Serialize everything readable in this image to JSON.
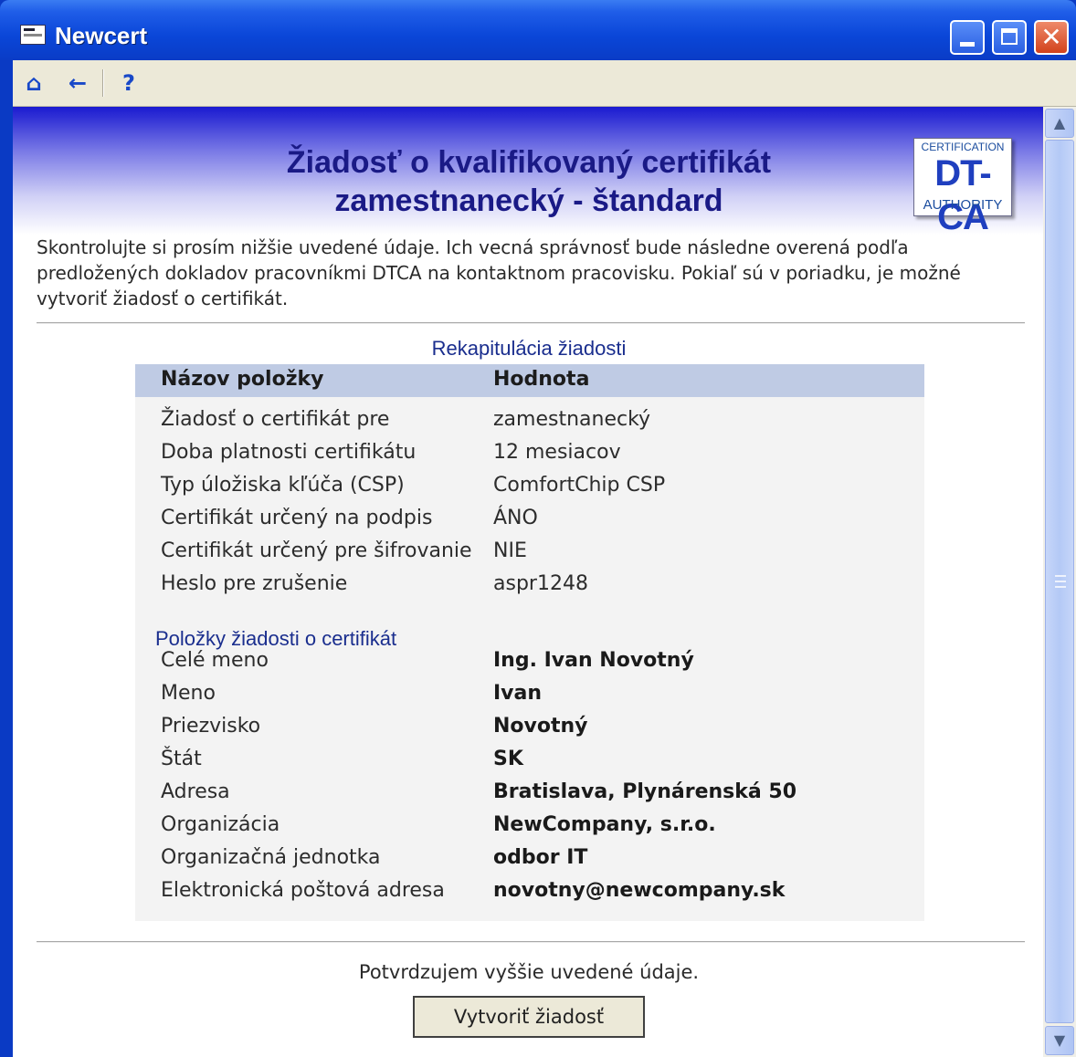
{
  "window": {
    "title": "Newcert",
    "close_glyph": "✕"
  },
  "toolbar": {
    "home_icon": "⌂",
    "back_icon": "←",
    "help_icon": "?"
  },
  "header": {
    "title_line1": "Žiadosť o kvalifikovaný certifikát",
    "title_line2": "zamestnanecký - štandard"
  },
  "logo": {
    "top": "CERTIFICATION",
    "main": "DT-CA",
    "bottom": "AUTHORITY"
  },
  "intro": "Skontrolujte si prosím nižšie uvedené údaje. Ich vecná správnosť bude následne overená podľa predložených dokladov pracovníkmi DTCA na kontaktnom pracovisku. Pokiaľ sú v poriadku, je možné vytvoriť žiadosť o certifikát.",
  "recap": {
    "title": "Rekapitulácia žiadosti",
    "col_name": "Názov položky",
    "col_value": "Hodnota",
    "rows": [
      {
        "label": "Žiadosť o certifikát pre",
        "value": "zamestnanecký"
      },
      {
        "label": "Doba platnosti certifikátu",
        "value": "12 mesiacov"
      },
      {
        "label": "Typ úložiska kľúča (CSP)",
        "value": "ComfortChip CSP"
      },
      {
        "label": "Certifikát určený na podpis",
        "value": "ÁNO"
      },
      {
        "label": "Certifikát určený pre šifrovanie",
        "value": "NIE"
      },
      {
        "label": "Heslo pre zrušenie",
        "value": "aspr1248"
      }
    ],
    "items_title": "Položky žiadosti o certifikát",
    "items": [
      {
        "label": "Celé meno",
        "value": "Ing. Ivan Novotný"
      },
      {
        "label": "Meno",
        "value": "Ivan"
      },
      {
        "label": "Priezvisko",
        "value": "Novotný"
      },
      {
        "label": "Štát",
        "value": "SK"
      },
      {
        "label": "Adresa",
        "value": "Bratislava, Plynárenská 50"
      },
      {
        "label": "Organizácia",
        "value": "NewCompany, s.r.o."
      },
      {
        "label": "Organizačná jednotka",
        "value": "odbor IT"
      },
      {
        "label": "Elektronická poštová adresa",
        "value": "novotny@newcompany.sk"
      }
    ]
  },
  "confirm_text": "Potvrdzujem vyššie uvedené údaje.",
  "create_button": "Vytvoriť žiadosť",
  "scrollbar": {
    "up_glyph": "▲",
    "down_glyph": "▼"
  }
}
